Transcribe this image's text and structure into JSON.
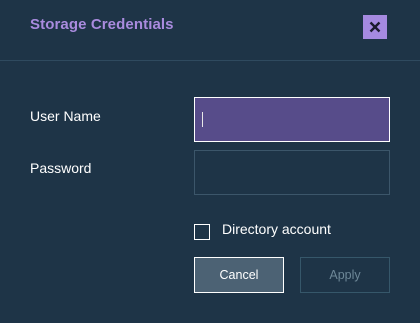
{
  "dialog": {
    "title": "Storage Credentials",
    "close_icon": "close-icon"
  },
  "form": {
    "username_label": "User Name",
    "username_value": "",
    "password_label": "Password",
    "password_value": "",
    "directory_account_label": "Directory account",
    "directory_account_checked": false
  },
  "buttons": {
    "cancel_label": "Cancel",
    "apply_label": "Apply",
    "apply_enabled": false
  },
  "colors": {
    "background": "#1e3447",
    "title": "#a98bde",
    "close_button": "#a58ae0",
    "focused_input": "#574c8a",
    "cancel_button": "#4c6274",
    "disabled_text": "#6d8797"
  }
}
